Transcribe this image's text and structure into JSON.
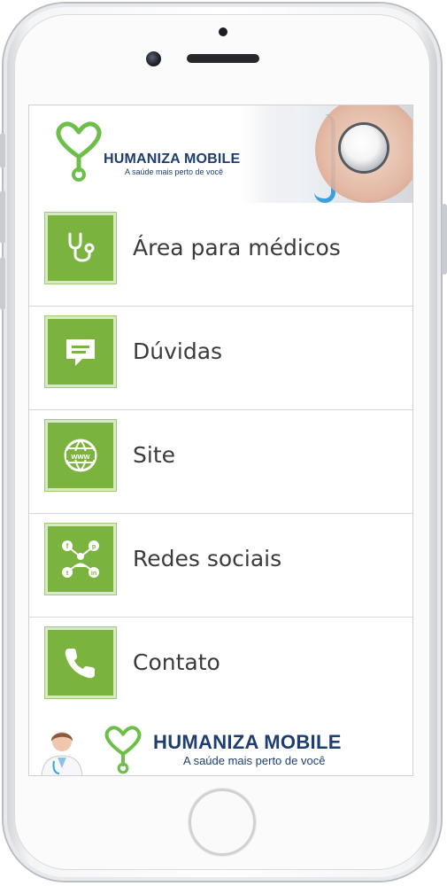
{
  "header": {
    "brand_title": "HUMANIZA MOBILE",
    "brand_subtitle": "A saúde mais perto de você"
  },
  "menu": {
    "items": [
      {
        "label": "Área para médicos",
        "icon": "stethoscope-icon"
      },
      {
        "label": "Dúvidas",
        "icon": "chat-bubble-icon"
      },
      {
        "label": "Site",
        "icon": "www-globe-icon"
      },
      {
        "label": "Redes sociais",
        "icon": "social-network-icon"
      },
      {
        "label": "Contato",
        "icon": "phone-handset-icon"
      }
    ]
  },
  "footer": {
    "brand_title": "HUMANIZA MOBILE",
    "brand_subtitle": "A saúde mais perto de você"
  },
  "colors": {
    "accent_green": "#7ab33e",
    "brand_navy": "#1d3e6e",
    "logo_green": "#6cc04a"
  }
}
